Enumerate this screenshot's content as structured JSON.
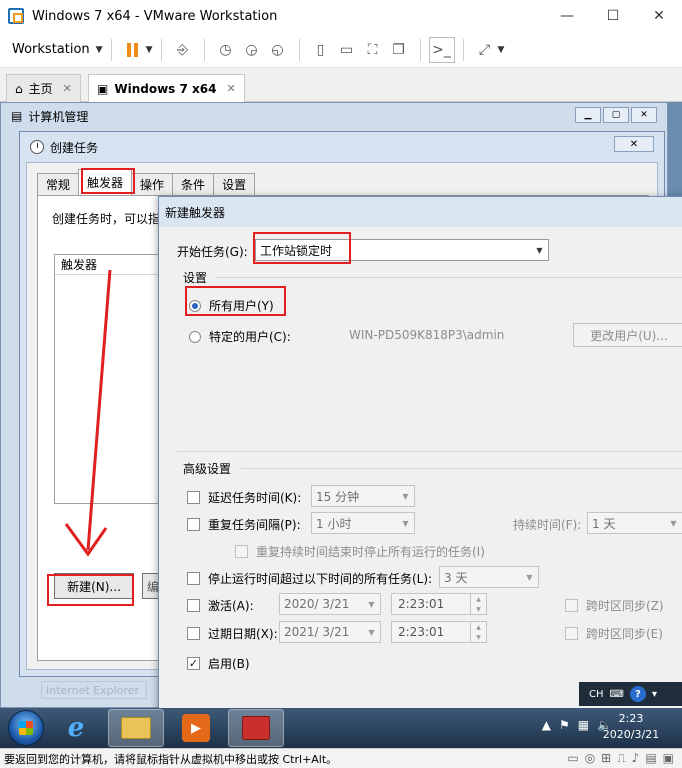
{
  "vmware": {
    "title": "Windows 7 x64 - VMware Workstation",
    "menu_label": "Workstation",
    "tabs": [
      {
        "label": "主页"
      },
      {
        "label": "Windows 7 x64"
      }
    ]
  },
  "computer_management": {
    "title": "计算机管理",
    "faint_label": "Internet Explorer"
  },
  "create_task": {
    "title": "创建任务",
    "close_label": "✕",
    "tabs": [
      {
        "label": "常规"
      },
      {
        "label": "触发器"
      },
      {
        "label": "操作"
      },
      {
        "label": "条件"
      },
      {
        "label": "设置"
      }
    ],
    "active_tab": "触发器",
    "description": "创建任务时，可以指",
    "list_header": "触发器",
    "new_button": "新建(N)...",
    "edit_stub": "编"
  },
  "new_trigger": {
    "title": "新建触发器",
    "begin_label": "开始任务(G):",
    "begin_value": "工作站锁定时",
    "settings_group": "设置",
    "radio_all_users": "所有用户(Y)",
    "radio_specific_user": "特定的用户(C):",
    "specific_user_value": "WIN-PD509K818P3\\admin",
    "change_user_button": "更改用户(U)...",
    "advanced_group": "高级设置",
    "delay_label": "延迟任务时间(K):",
    "delay_value": "15 分钟",
    "repeat_label": "重复任务间隔(P):",
    "repeat_value": "1 小时",
    "duration_label": "持续时间(F):",
    "duration_value": "1 天",
    "stop_at_end_label": "重复持续时间结束时停止所有运行的任务(I)",
    "stop_longer_label": "停止运行时间超过以下时间的所有任务(L):",
    "stop_longer_value": "3 天",
    "activate_label": "激活(A):",
    "activate_date": "2020/ 3/21",
    "activate_time": "2:23:01",
    "sync_tz_z": "跨时区同步(Z)",
    "expire_label": "过期日期(X):",
    "expire_date": "2021/ 3/21",
    "expire_time": "2:23:01",
    "sync_tz_e": "跨时区同步(E)",
    "enabled_label": "启用(B)"
  },
  "vm_mini": {
    "lang": "CH"
  },
  "taskbar": {
    "time": "2:23",
    "date": "2020/3/21"
  },
  "statusbar": {
    "text": "要返回到您的计算机，请将鼠标指针从虚拟机中移出或按 Ctrl+Alt。"
  },
  "colors": {
    "highlight": "#e02020",
    "accent": "#2a62bf"
  }
}
